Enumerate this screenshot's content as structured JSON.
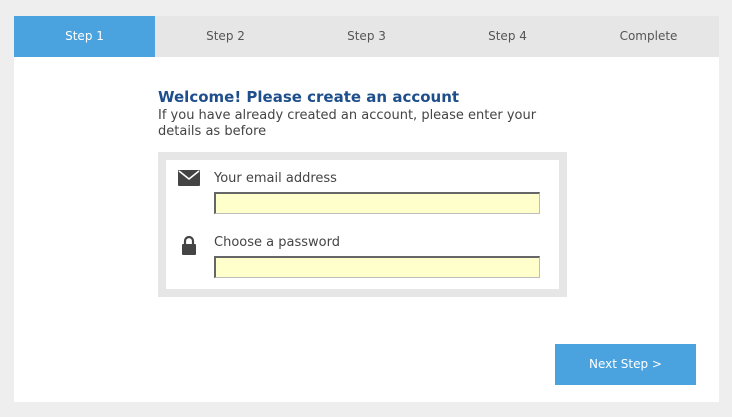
{
  "steps": [
    {
      "label": "Step 1",
      "active": true
    },
    {
      "label": "Step 2",
      "active": false
    },
    {
      "label": "Step 3",
      "active": false
    },
    {
      "label": "Step 4",
      "active": false
    },
    {
      "label": "Complete",
      "active": false
    }
  ],
  "form": {
    "title": "Welcome! Please create an account",
    "subtitle": "If you have already created an account, please enter your details as before",
    "email": {
      "label": "Your email address",
      "value": "",
      "icon": "envelope-icon"
    },
    "password": {
      "label": "Choose a password",
      "value": "",
      "icon": "lock-icon"
    }
  },
  "actions": {
    "next_label": "Next Step >"
  },
  "colors": {
    "accent": "#4aa3df",
    "title": "#1e4f8c",
    "input_bg": "#ffffcc",
    "tab_bg": "#e6e6e6"
  }
}
